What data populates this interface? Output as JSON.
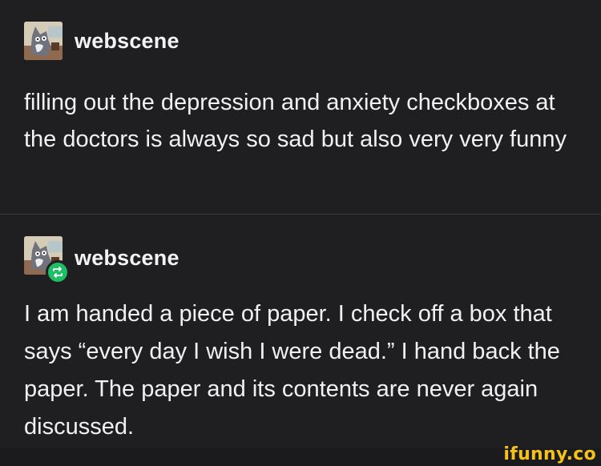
{
  "posts": [
    {
      "username": "webscene",
      "avatar_icon": "cartoon-cat-avatar",
      "is_reblog": false,
      "body": "filling out the depression and anxiety checkboxes at the doctors is always so sad but also very very funny"
    },
    {
      "username": "webscene",
      "avatar_icon": "cartoon-cat-avatar",
      "is_reblog": true,
      "reblog_icon": "reblog-icon",
      "body": "I am handed a piece of paper. I check off a box that says “every day I wish I were dead.” I hand back the paper. The paper and its contents are never again discussed."
    }
  ],
  "watermark": {
    "text": "ifunny.co",
    "color": "#f5c21b"
  },
  "colors": {
    "background": "#1f1f21",
    "text": "#f1f1f1",
    "reblog_green": "#1fbd66"
  }
}
